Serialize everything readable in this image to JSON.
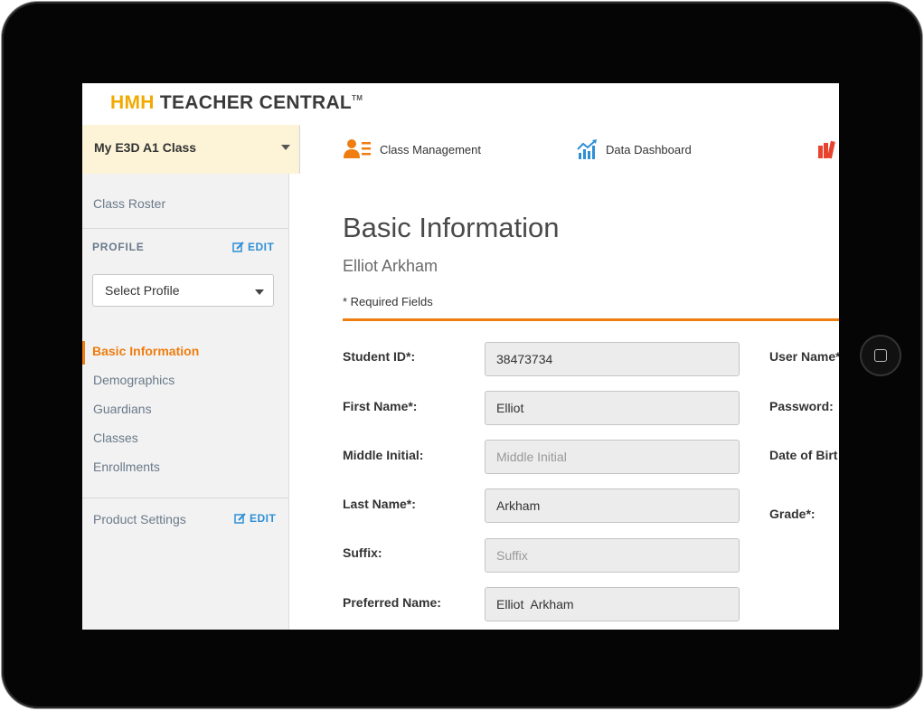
{
  "header": {
    "logo_brand": "HMH",
    "logo_product": "TEACHER CENTRAL",
    "logo_tm": "TM"
  },
  "class_selector": {
    "selected": "My E3D A1 Class"
  },
  "nav": {
    "items": [
      {
        "label": "Class Management",
        "icon": "users-list-icon"
      },
      {
        "label": "Data Dashboard",
        "icon": "chart-icon"
      },
      {
        "label": "",
        "icon": "books-icon"
      }
    ]
  },
  "sidebar": {
    "class_roster": "Class Roster",
    "profile_heading": "PROFILE",
    "edit_label": "EDIT",
    "profile_select": "Select Profile",
    "items": [
      "Basic Information",
      "Demographics",
      "Guardians",
      "Classes",
      "Enrollments"
    ],
    "active_item": "Basic Information",
    "product_settings": "Product Settings"
  },
  "main": {
    "title": "Basic Information",
    "student_name": "Elliot Arkham",
    "required_note": "* Required Fields",
    "fields": [
      {
        "label": "Student ID*:",
        "value": "38473734",
        "placeholder": ""
      },
      {
        "label": "First Name*:",
        "value": "Elliot",
        "placeholder": ""
      },
      {
        "label": "Middle Initial:",
        "value": "",
        "placeholder": "Middle Initial"
      },
      {
        "label": "Last Name*:",
        "value": "Arkham",
        "placeholder": ""
      },
      {
        "label": "Suffix:",
        "value": "",
        "placeholder": "Suffix"
      },
      {
        "label": "Preferred Name:",
        "value": "Elliot  Arkham",
        "placeholder": ""
      }
    ],
    "right_labels": [
      "User Name*",
      "Password:",
      "Date of Birt",
      "Grade*:"
    ]
  },
  "colors": {
    "accent_orange": "#ef7d10",
    "brand_gold": "#f2a900",
    "link_blue": "#2e8fd6",
    "class_bar_bg": "#fdf4d8"
  }
}
